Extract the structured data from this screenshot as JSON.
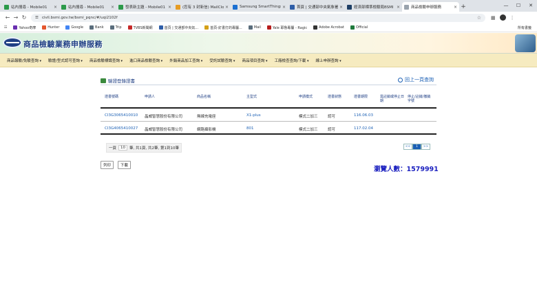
{
  "browser": {
    "tabs": [
      {
        "title": "站內搜尋 - Mobile01",
        "color": "#2c9a4a"
      },
      {
        "title": "站內搜尋 - Mobile01",
        "color": "#2c9a4a"
      },
      {
        "title": "發表新主題 - Mobile01",
        "color": "#2c9a4a"
      },
      {
        "title": "(您有 3 封新信) MailClou",
        "color": "#e69c24"
      },
      {
        "title": "Samsung SmartThings",
        "color": "#1a6fd1"
      },
      {
        "title": "首頁 | 交通部中央氣象署",
        "color": "#2f5ea8"
      },
      {
        "title": "經濟部標準檢驗局BSMI",
        "color": "#1e3f66"
      },
      {
        "title": "商品檢驗申辦服務",
        "color": "#9aa3ad"
      }
    ],
    "url": "civil.bsmi.gov.tw/bsmi_pqnc/#/uqi2102f",
    "bookmarks": [
      {
        "label": "Yahoo奇摩",
        "color": "#6a2fb0"
      },
      {
        "label": "Hunter",
        "color": "#e4572e"
      },
      {
        "label": "Google",
        "color": "#4285f4"
      },
      {
        "label": "Bank",
        "color": "#5a6d7c"
      },
      {
        "label": "Trip",
        "color": "#5a6d7c"
      },
      {
        "label": "TVBS新聞網",
        "color": "#c62828"
      },
      {
        "label": "首頁 | 交通部中央氣...",
        "color": "#2f5ea8"
      },
      {
        "label": "首頁-釘書打的專屬...",
        "color": "#d4a017"
      },
      {
        "label": "Mail",
        "color": "#5a6d7c"
      },
      {
        "label": "Yale 耶魯專屬 - Ragic",
        "color": "#b71c1c"
      },
      {
        "label": "Adobe Acrobat",
        "color": "#333333"
      },
      {
        "label": "Official",
        "color": "#1f7a3c"
      }
    ],
    "all_bookmarks": "所有書籤"
  },
  "site": {
    "title": "商品檢驗業務申辦服務",
    "menu": [
      "商品報驗/免驗查詢",
      "驗證/型式認可查詢",
      "商品檢驗標識查詢",
      "進口商品檢驗查詢",
      "外銷商品加工查詢",
      "受託試驗查詢",
      "商品項目查詢",
      "工廠檢查查詢/下載",
      "線上申辦查詢"
    ]
  },
  "main": {
    "section_title": "驗證登錄證書",
    "back_link": "回上一頁查詢",
    "columns": [
      "證書號碼",
      "申請人",
      "商品名稱",
      "主型式",
      "申請模式",
      "證書狀態",
      "證書期限",
      "需註銷或停止日期",
      "停止/註銷/撤銷字號"
    ],
    "rows": [
      [
        "CI3G3065410010",
        "晶威智慧股份有限公司",
        "無線充電座",
        "X1-plus",
        "模式二加三",
        "認可",
        "116.06.03",
        "",
        ""
      ],
      [
        "CI3G4065410027",
        "晶威智慧股份有限公司",
        "網路攝影機",
        "801",
        "模式二加三",
        "認可",
        "117.02.04",
        "",
        ""
      ]
    ],
    "pager": {
      "prefix": "一頁",
      "page_size": "10",
      "summary": "筆, 共1頁, 共2筆, 第1到10筆",
      "prev": "<<",
      "current": "1",
      "next": ">>"
    },
    "print_label": "列印",
    "download_label": "下載",
    "visits": "瀏覽人數：1579991"
  }
}
